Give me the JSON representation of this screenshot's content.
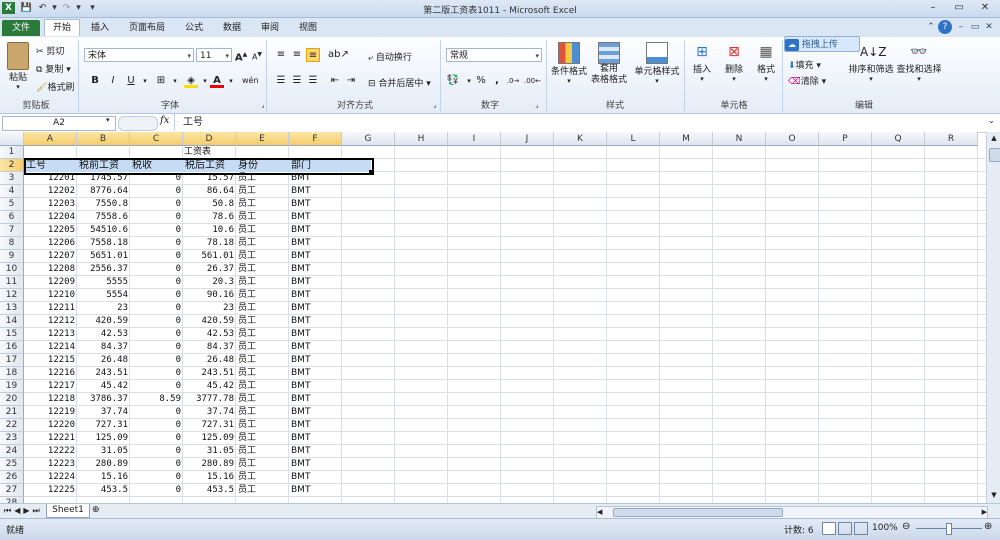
{
  "window": {
    "title": "第二版工资表1011 - Microsoft Excel",
    "app_icon": "X"
  },
  "tabs": [
    "文件",
    "开始",
    "插入",
    "页面布局",
    "公式",
    "数据",
    "审阅",
    "视图"
  ],
  "active_tab": "开始",
  "ribbon": {
    "clipboard": {
      "paste": "粘贴",
      "cut": "剪切",
      "copy": "复制",
      "format_painter": "格式刷",
      "label": "剪贴板"
    },
    "font": {
      "name": "宋体",
      "size": "11",
      "label": "字体",
      "bold": "B",
      "italic": "I",
      "underline": "U",
      "grow": "A",
      "shrink": "A",
      "wen": "wén"
    },
    "alignment": {
      "wrap": "自动换行",
      "merge": "合并后居中",
      "label": "对齐方式"
    },
    "number": {
      "format": "常规",
      "percent": "%",
      "comma": ",",
      "label": "数字"
    },
    "styles": {
      "conditional": "条件格式",
      "table": "套用\n表格格式",
      "cell": "单元格样式",
      "label": "样式"
    },
    "cells": {
      "insert": "插入",
      "delete": "删除",
      "format": "格式",
      "label": "单元格"
    },
    "editing": {
      "fill": "填充",
      "clear": "清除",
      "sort": "排序和筛选",
      "find": "查找和选择",
      "label": "编辑",
      "upload": "拖拽上传"
    }
  },
  "formula_bar": {
    "name_box": "A2",
    "fx": "fx",
    "content": "工号"
  },
  "columns": [
    "A",
    "B",
    "C",
    "D",
    "E",
    "F",
    "G",
    "H",
    "I",
    "J",
    "K",
    "L",
    "M",
    "N",
    "O",
    "P",
    "Q",
    "R"
  ],
  "sheet": {
    "title": "工资表",
    "headers": [
      "工号",
      "税前工资",
      "税收",
      "税后工资",
      "身份",
      "部门"
    ],
    "rows": [
      [
        "12201",
        "1745.57",
        "0",
        "15.57",
        "员工",
        "BMT"
      ],
      [
        "12202",
        "8776.64",
        "0",
        "86.64",
        "员工",
        "BMT"
      ],
      [
        "12203",
        "7550.8",
        "0",
        "50.8",
        "员工",
        "BMT"
      ],
      [
        "12204",
        "7558.6",
        "0",
        "78.6",
        "员工",
        "BMT"
      ],
      [
        "12205",
        "54510.6",
        "0",
        "10.6",
        "员工",
        "BMT"
      ],
      [
        "12206",
        "7558.18",
        "0",
        "78.18",
        "员工",
        "BMT"
      ],
      [
        "12207",
        "5651.01",
        "0",
        "561.01",
        "员工",
        "BMT"
      ],
      [
        "12208",
        "2556.37",
        "0",
        "26.37",
        "员工",
        "BMT"
      ],
      [
        "12209",
        "5555",
        "0",
        "20.3",
        "员工",
        "BMT"
      ],
      [
        "12210",
        "5554",
        "0",
        "90.16",
        "员工",
        "BMT"
      ],
      [
        "12211",
        "23",
        "0",
        "23",
        "员工",
        "BMT"
      ],
      [
        "12212",
        "420.59",
        "0",
        "420.59",
        "员工",
        "BMT"
      ],
      [
        "12213",
        "42.53",
        "0",
        "42.53",
        "员工",
        "BMT"
      ],
      [
        "12214",
        "84.37",
        "0",
        "84.37",
        "员工",
        "BMT"
      ],
      [
        "12215",
        "26.48",
        "0",
        "26.48",
        "员工",
        "BMT"
      ],
      [
        "12216",
        "243.51",
        "0",
        "243.51",
        "员工",
        "BMT"
      ],
      [
        "12217",
        "45.42",
        "0",
        "45.42",
        "员工",
        "BMT"
      ],
      [
        "12218",
        "3786.37",
        "8.59",
        "3777.78",
        "员工",
        "BMT"
      ],
      [
        "12219",
        "37.74",
        "0",
        "37.74",
        "员工",
        "BMT"
      ],
      [
        "12220",
        "727.31",
        "0",
        "727.31",
        "员工",
        "BMT"
      ],
      [
        "12221",
        "125.09",
        "0",
        "125.09",
        "员工",
        "BMT"
      ],
      [
        "12222",
        "31.05",
        "0",
        "31.05",
        "员工",
        "BMT"
      ],
      [
        "12223",
        "280.89",
        "0",
        "280.89",
        "员工",
        "BMT"
      ],
      [
        "12224",
        "15.16",
        "0",
        "15.16",
        "员工",
        "BMT"
      ],
      [
        "12225",
        "453.5",
        "0",
        "453.5",
        "员工",
        "BMT"
      ]
    ]
  },
  "sheet_tabs": [
    "Sheet1"
  ],
  "status": {
    "ready": "就绪",
    "count": "计数: 6",
    "zoom": "100%"
  },
  "colors": {
    "excel_green": "#2a7a3b",
    "selection_fill": "#c5dcf4",
    "header_selected": "#f5cc6a"
  }
}
